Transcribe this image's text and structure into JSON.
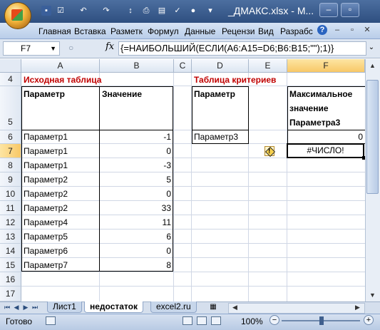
{
  "window": {
    "title": "_ДМАКС.xlsx - M..."
  },
  "quick_access": {
    "icons": [
      "save-icon",
      "undo-icon",
      "redo-icon",
      "print-icon",
      "preview-icon",
      "circle-icon"
    ]
  },
  "ribbon": {
    "tabs": [
      "Главная",
      "Вставка",
      "Разметк",
      "Формул",
      "Данные",
      "Рецензи",
      "Вид",
      "Разрабс"
    ]
  },
  "formula_bar": {
    "name_box": "F7",
    "fx": "fx",
    "formula": "{=НАИБОЛЬШИЙ(ЕСЛИ(A6:A15=D6;B6:B15;\"\");1)}"
  },
  "columns": [
    "A",
    "B",
    "C",
    "D",
    "E",
    "F"
  ],
  "selected_column": "F",
  "rows": [
    "4",
    "5",
    "6",
    "7",
    "8",
    "9",
    "10",
    "11",
    "12",
    "13",
    "14",
    "15",
    "16",
    "17"
  ],
  "selected_row": "7",
  "sheet": {
    "source_title": "Исходная таблица",
    "criteria_title": "Таблица критериев",
    "header_param": "Параметр",
    "header_value": "Значение",
    "criteria_header_param": "Параметр",
    "criteria_header_max_line1": "Максимальное",
    "criteria_header_max_line2": "значение",
    "criteria_header_max_line3": "Параметра3",
    "data": [
      {
        "param": "Параметр1",
        "value": "-1"
      },
      {
        "param": "Параметр1",
        "value": "0"
      },
      {
        "param": "Параметр1",
        "value": "-3"
      },
      {
        "param": "Параметр2",
        "value": "5"
      },
      {
        "param": "Параметр2",
        "value": "0"
      },
      {
        "param": "Параметр2",
        "value": "33"
      },
      {
        "param": "Параметр4",
        "value": "11"
      },
      {
        "param": "Параметр5",
        "value": "6"
      },
      {
        "param": "Параметр6",
        "value": "0"
      },
      {
        "param": "Параметр7",
        "value": "8"
      }
    ],
    "criteria_param": "Параметр3",
    "f6_value": "0",
    "f7_value": "#ЧИСЛО!"
  },
  "sheet_tabs": [
    "Лист1",
    "недостаток",
    "excel2.ru"
  ],
  "active_sheet": "недостаток",
  "status": {
    "text": "Готово",
    "zoom": "100%"
  }
}
